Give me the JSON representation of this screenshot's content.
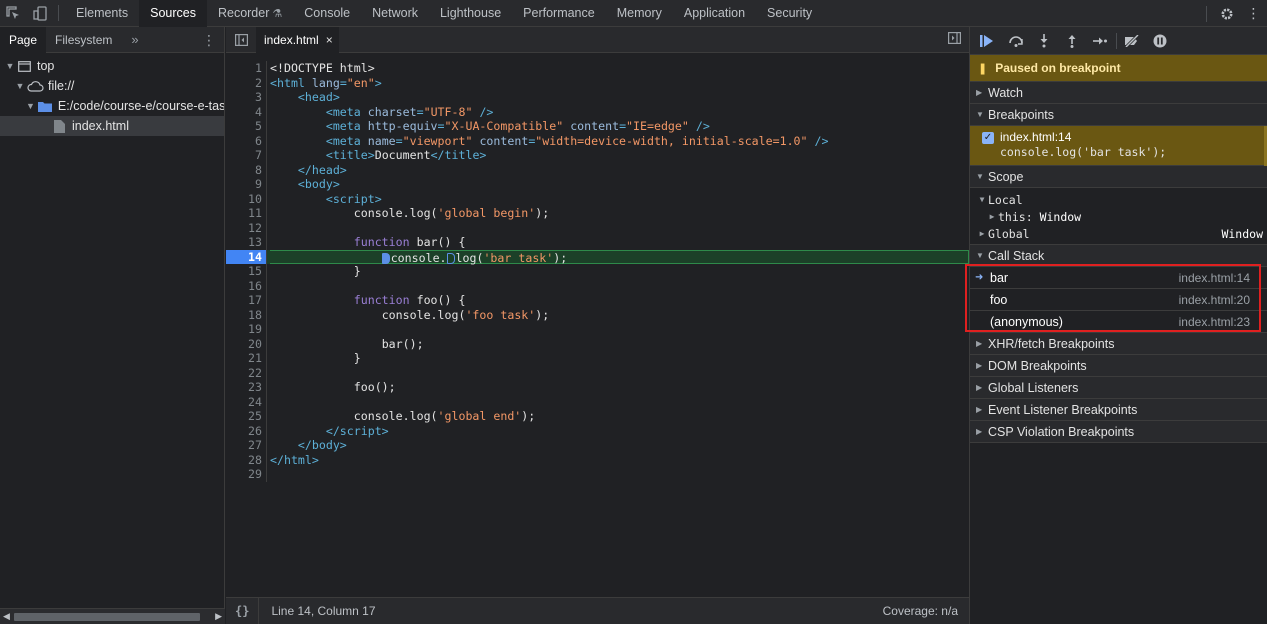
{
  "topbar": {
    "tabs": [
      {
        "label": "Elements",
        "active": false
      },
      {
        "label": "Sources",
        "active": true
      },
      {
        "label": "Recorder",
        "active": false
      },
      {
        "label": "Console",
        "active": false
      },
      {
        "label": "Network",
        "active": false
      },
      {
        "label": "Lighthouse",
        "active": false
      },
      {
        "label": "Performance",
        "active": false
      },
      {
        "label": "Memory",
        "active": false
      },
      {
        "label": "Application",
        "active": false
      },
      {
        "label": "Security",
        "active": false
      }
    ],
    "icons": [
      "inspect-element-icon",
      "device-toolbar-icon",
      "settings-icon",
      "more-options-icon"
    ]
  },
  "navigator": {
    "tabs": [
      {
        "label": "Page",
        "active": true
      },
      {
        "label": "Filesystem",
        "active": false
      }
    ],
    "more": "»",
    "tree": [
      {
        "label": "top",
        "depth": 0,
        "expanded": true,
        "icon": "frame-icon"
      },
      {
        "label": "file://",
        "depth": 1,
        "expanded": true,
        "icon": "cloud-icon"
      },
      {
        "label": "E:/code/course-e/course-e-tasl",
        "depth": 2,
        "expanded": true,
        "icon": "folder-icon"
      },
      {
        "label": "index.html",
        "depth": 3,
        "selected": true,
        "icon": "file-icon"
      }
    ]
  },
  "editor": {
    "file_tab": "index.html",
    "close_glyph": "×",
    "current_line": 14,
    "lines": [
      {
        "n": 1,
        "html": "<span class=\"tx\">&lt;!DOCTYPE html&gt;</span>"
      },
      {
        "n": 2,
        "html": "<span class=\"tag\">&lt;html</span> <span class=\"attr\">lang</span><span class=\"tag\">=</span><span class=\"str\">\"en\"</span><span class=\"tag\">&gt;</span>"
      },
      {
        "n": 3,
        "html": "    <span class=\"tag\">&lt;head&gt;</span>"
      },
      {
        "n": 4,
        "html": "        <span class=\"tag\">&lt;meta</span> <span class=\"attr\">charset</span><span class=\"tag\">=</span><span class=\"str\">\"UTF-8\"</span> <span class=\"tag\">/&gt;</span>"
      },
      {
        "n": 5,
        "html": "        <span class=\"tag\">&lt;meta</span> <span class=\"attr\">http-equiv</span><span class=\"tag\">=</span><span class=\"str\">\"X-UA-Compatible\"</span> <span class=\"attr\">content</span><span class=\"tag\">=</span><span class=\"str\">\"IE=edge\"</span> <span class=\"tag\">/&gt;</span>"
      },
      {
        "n": 6,
        "html": "        <span class=\"tag\">&lt;meta</span> <span class=\"attr\">name</span><span class=\"tag\">=</span><span class=\"str\">\"viewport\"</span> <span class=\"attr\">content</span><span class=\"tag\">=</span><span class=\"str\">\"width=device-width, initial-scale=1.0\"</span> <span class=\"tag\">/&gt;</span>"
      },
      {
        "n": 7,
        "html": "        <span class=\"tag\">&lt;title&gt;</span><span class=\"tx\">Document</span><span class=\"tag\">&lt;/title&gt;</span>"
      },
      {
        "n": 8,
        "html": "    <span class=\"tag\">&lt;/head&gt;</span>"
      },
      {
        "n": 9,
        "html": "    <span class=\"tag\">&lt;body&gt;</span>"
      },
      {
        "n": 10,
        "html": "        <span class=\"tag\">&lt;script&gt;</span>"
      },
      {
        "n": 11,
        "html": "            <span class=\"tx\">console.log(</span><span class=\"str\">'global begin'</span><span class=\"tx\">);</span>"
      },
      {
        "n": 12,
        "html": ""
      },
      {
        "n": 13,
        "html": "            <span class=\"kw\">function</span> <span class=\"tx\">bar() {</span>"
      },
      {
        "n": 14,
        "html": "                <span class=\"bp-mark\"></span><span class=\"tx\">console.</span><span class=\"bp-mark hollow\"></span><span class=\"tx\">log(</span><span class=\"str\">'bar task'</span><span class=\"tx\">);</span>"
      },
      {
        "n": 15,
        "html": "            <span class=\"tx\">}</span>"
      },
      {
        "n": 16,
        "html": ""
      },
      {
        "n": 17,
        "html": "            <span class=\"kw\">function</span> <span class=\"tx\">foo() {</span>"
      },
      {
        "n": 18,
        "html": "                <span class=\"tx\">console.log(</span><span class=\"str\">'foo task'</span><span class=\"tx\">);</span>"
      },
      {
        "n": 19,
        "html": ""
      },
      {
        "n": 20,
        "html": "                <span class=\"tx\">bar();</span>"
      },
      {
        "n": 21,
        "html": "            <span class=\"tx\">}</span>"
      },
      {
        "n": 22,
        "html": ""
      },
      {
        "n": 23,
        "html": "            <span class=\"tx\">foo();</span>"
      },
      {
        "n": 24,
        "html": ""
      },
      {
        "n": 25,
        "html": "            <span class=\"tx\">console.log(</span><span class=\"str\">'global end'</span><span class=\"tx\">);</span>"
      },
      {
        "n": 26,
        "html": "        <span class=\"tag\">&lt;/script&gt;</span>"
      },
      {
        "n": 27,
        "html": "    <span class=\"tag\">&lt;/body&gt;</span>"
      },
      {
        "n": 28,
        "html": "<span class=\"tag\">&lt;/html&gt;</span>"
      },
      {
        "n": 29,
        "html": ""
      }
    ],
    "status": {
      "braces": "{}",
      "position": "Line 14, Column 17",
      "coverage": "Coverage: n/a"
    }
  },
  "debugger": {
    "toolbar_icons": [
      "resume-icon",
      "step-over-icon",
      "step-into-icon",
      "step-out-icon",
      "step-icon",
      "deactivate-breakpoints-icon",
      "pause-on-exceptions-icon"
    ],
    "paused_message": "Paused on breakpoint",
    "sections": {
      "watch": "Watch",
      "breakpoints": "Breakpoints",
      "scope": "Scope",
      "call_stack": "Call Stack",
      "xhr": "XHR/fetch Breakpoints",
      "dom": "DOM Breakpoints",
      "global_listeners": "Global Listeners",
      "event_listener": "Event Listener Breakpoints",
      "csp": "CSP Violation Breakpoints"
    },
    "breakpoint": {
      "checked": true,
      "location": "index.html:14",
      "code": "console.log('bar task');"
    },
    "scope": {
      "local_label": "Local",
      "this_key": "this:",
      "this_value": "Window",
      "global_label": "Global",
      "global_value": "Window"
    },
    "call_stack": [
      {
        "name": "bar",
        "location": "index.html:14",
        "current": true
      },
      {
        "name": "foo",
        "location": "index.html:20",
        "current": false
      },
      {
        "name": "(anonymous)",
        "location": "index.html:23",
        "current": false
      }
    ]
  },
  "colors": {
    "paused_banner": "#6a5712",
    "current_line": "#1c4028",
    "accent": "#8ab4f8",
    "highlight_box": "#e02020"
  }
}
